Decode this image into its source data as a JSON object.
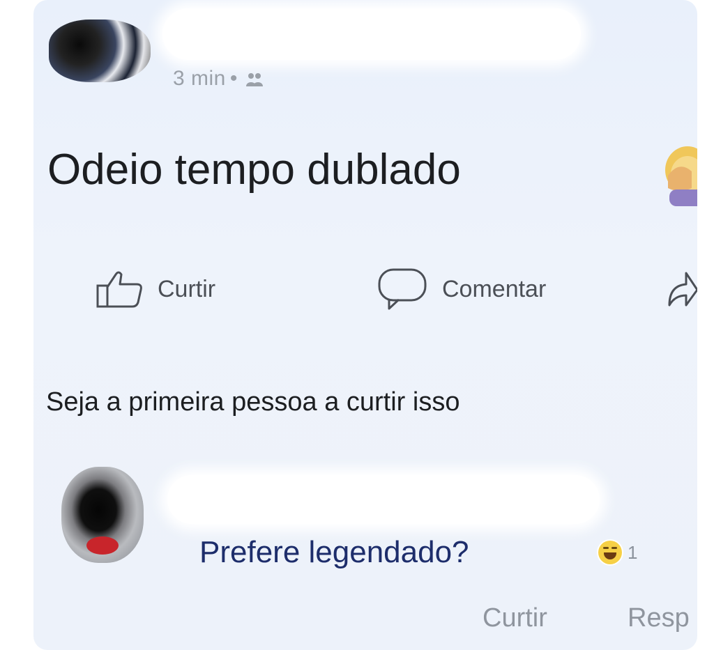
{
  "post": {
    "time": "3 min",
    "separator": "•",
    "audience_icon": "friends-icon",
    "text": "Odeio tempo dublado",
    "emoji": "face-palm-emoji"
  },
  "actions": {
    "like_label": "Curtir",
    "comment_label": "Comentar",
    "share_icon": "share-icon"
  },
  "likes_summary": "Seja a primeira pessoa a curtir isso",
  "comment": {
    "text": "Prefere legendado?",
    "reaction_icon": "haha-emoji",
    "reaction_count": "1",
    "like_label": "Curtir",
    "reply_label": "Resp"
  },
  "colors": {
    "card_background": "#edf2fa",
    "post_text": "#1c1e21",
    "comment_text": "#1d2d6b",
    "muted": "#8f959e"
  }
}
